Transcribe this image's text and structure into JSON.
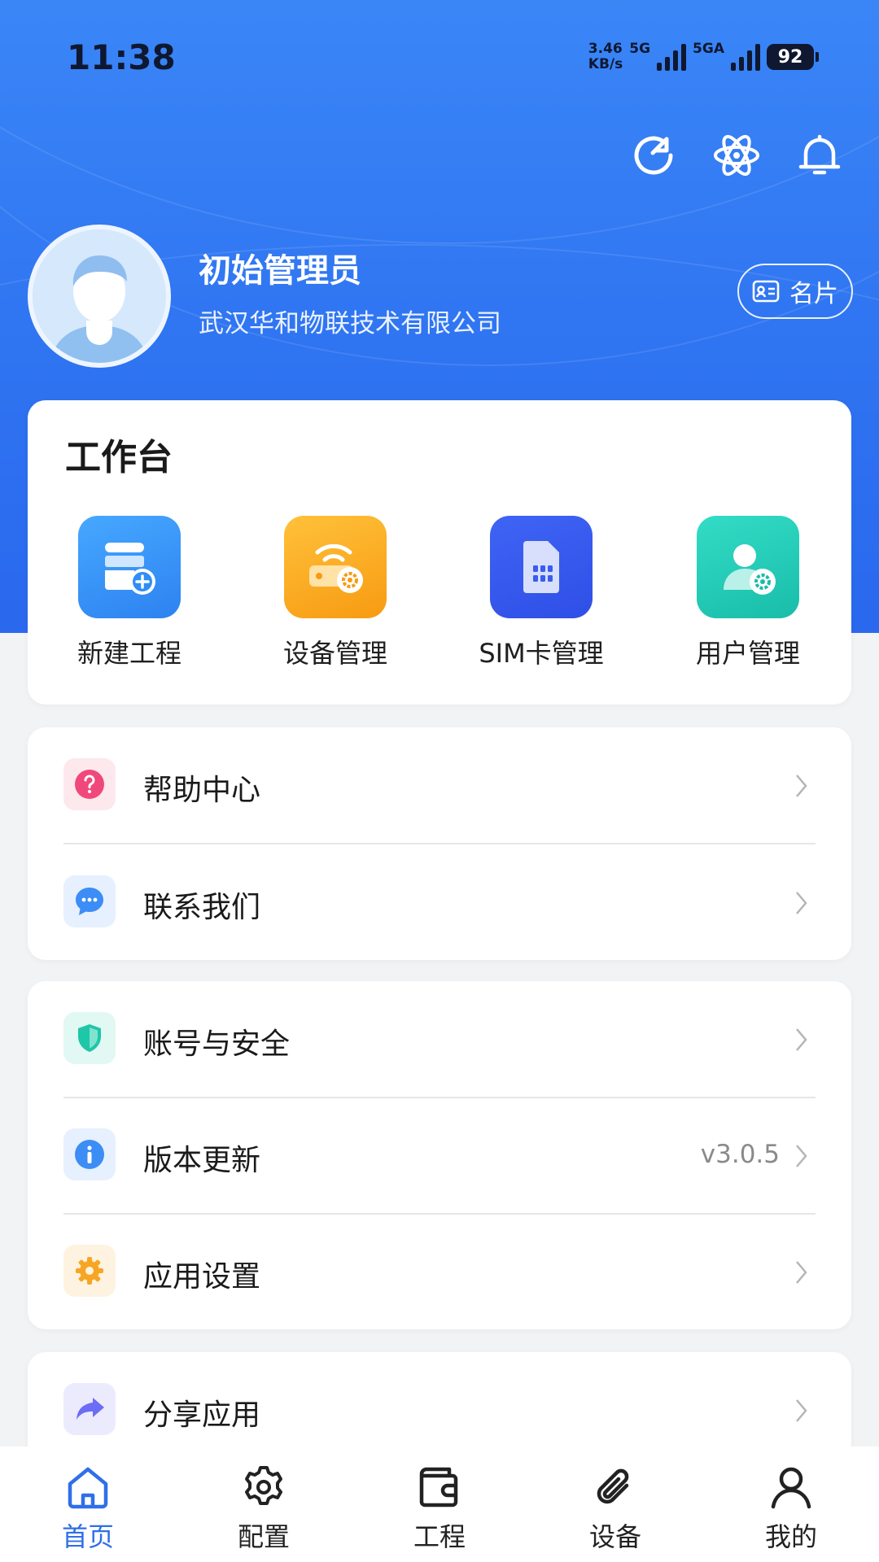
{
  "status_bar": {
    "time": "11:38",
    "net_speed_value": "3.46",
    "net_speed_unit": "KB/s",
    "signal1_label": "5G",
    "signal2_label": "5GA",
    "battery": "92"
  },
  "header": {
    "icons": [
      "refresh-icon",
      "atom-icon",
      "bell-icon"
    ]
  },
  "profile": {
    "name": "初始管理员",
    "company": "武汉华和物联技术有限公司",
    "card_button_label": "名片"
  },
  "workbench": {
    "title": "工作台",
    "items": [
      {
        "label": "新建工程",
        "icon": "new-project-icon",
        "color": "#2f8ef5"
      },
      {
        "label": "设备管理",
        "icon": "device-manage-icon",
        "color": "#f9a91e"
      },
      {
        "label": "SIM卡管理",
        "icon": "sim-card-icon",
        "color": "#3a5cf0"
      },
      {
        "label": "用户管理",
        "icon": "user-manage-icon",
        "color": "#1ec7b3"
      }
    ]
  },
  "menu_group_1": [
    {
      "label": "帮助中心",
      "icon": "help-icon",
      "color": "#f0487a"
    },
    {
      "label": "联系我们",
      "icon": "chat-icon",
      "color": "#3c8df5"
    }
  ],
  "menu_group_2": [
    {
      "label": "账号与安全",
      "icon": "shield-icon",
      "color": "#1ec7a8"
    },
    {
      "label": "版本更新",
      "icon": "info-icon",
      "color": "#3c8df5",
      "value": "v3.0.5"
    },
    {
      "label": "应用设置",
      "icon": "gear-icon",
      "color": "#f6a623"
    }
  ],
  "menu_group_3": [
    {
      "label": "分享应用",
      "icon": "share-icon",
      "color": "#6d6cf5"
    }
  ],
  "tabbar": [
    {
      "label": "首页",
      "icon": "home-icon",
      "active": true
    },
    {
      "label": "配置",
      "icon": "settings-icon",
      "active": false
    },
    {
      "label": "工程",
      "icon": "wallet-icon",
      "active": false
    },
    {
      "label": "设备",
      "icon": "paperclip-icon",
      "active": false
    },
    {
      "label": "我的",
      "icon": "user-icon",
      "active": false
    }
  ],
  "colors": {
    "header_blue": "#2f74f1",
    "accent": "#2f6fe8"
  }
}
